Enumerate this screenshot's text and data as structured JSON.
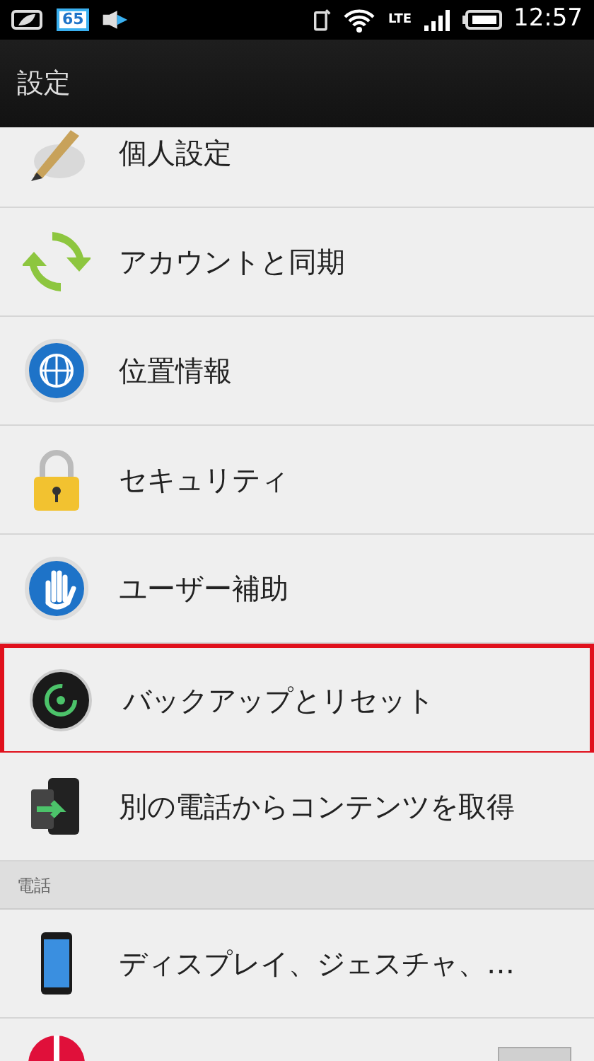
{
  "status_bar": {
    "badge": "65",
    "network": "LTE",
    "time": "12:57"
  },
  "title_bar": {
    "title": "設定"
  },
  "list": [
    {
      "kind": "item",
      "label": "個人設定",
      "highlighted": false
    },
    {
      "kind": "item",
      "label": "アカウントと同期",
      "highlighted": false
    },
    {
      "kind": "item",
      "label": "位置情報",
      "highlighted": false
    },
    {
      "kind": "item",
      "label": "セキュリティ",
      "highlighted": false
    },
    {
      "kind": "item",
      "label": "ユーザー補助",
      "highlighted": false
    },
    {
      "kind": "item",
      "label": "バックアップとリセット",
      "highlighted": true
    },
    {
      "kind": "item",
      "label": "別の電話からコンテンツを取得",
      "highlighted": false
    },
    {
      "kind": "header",
      "label": "電話"
    },
    {
      "kind": "item",
      "label": "ディスプレイ、ジェスチャ、…",
      "highlighted": false
    },
    {
      "kind": "toggle",
      "on": false
    }
  ]
}
